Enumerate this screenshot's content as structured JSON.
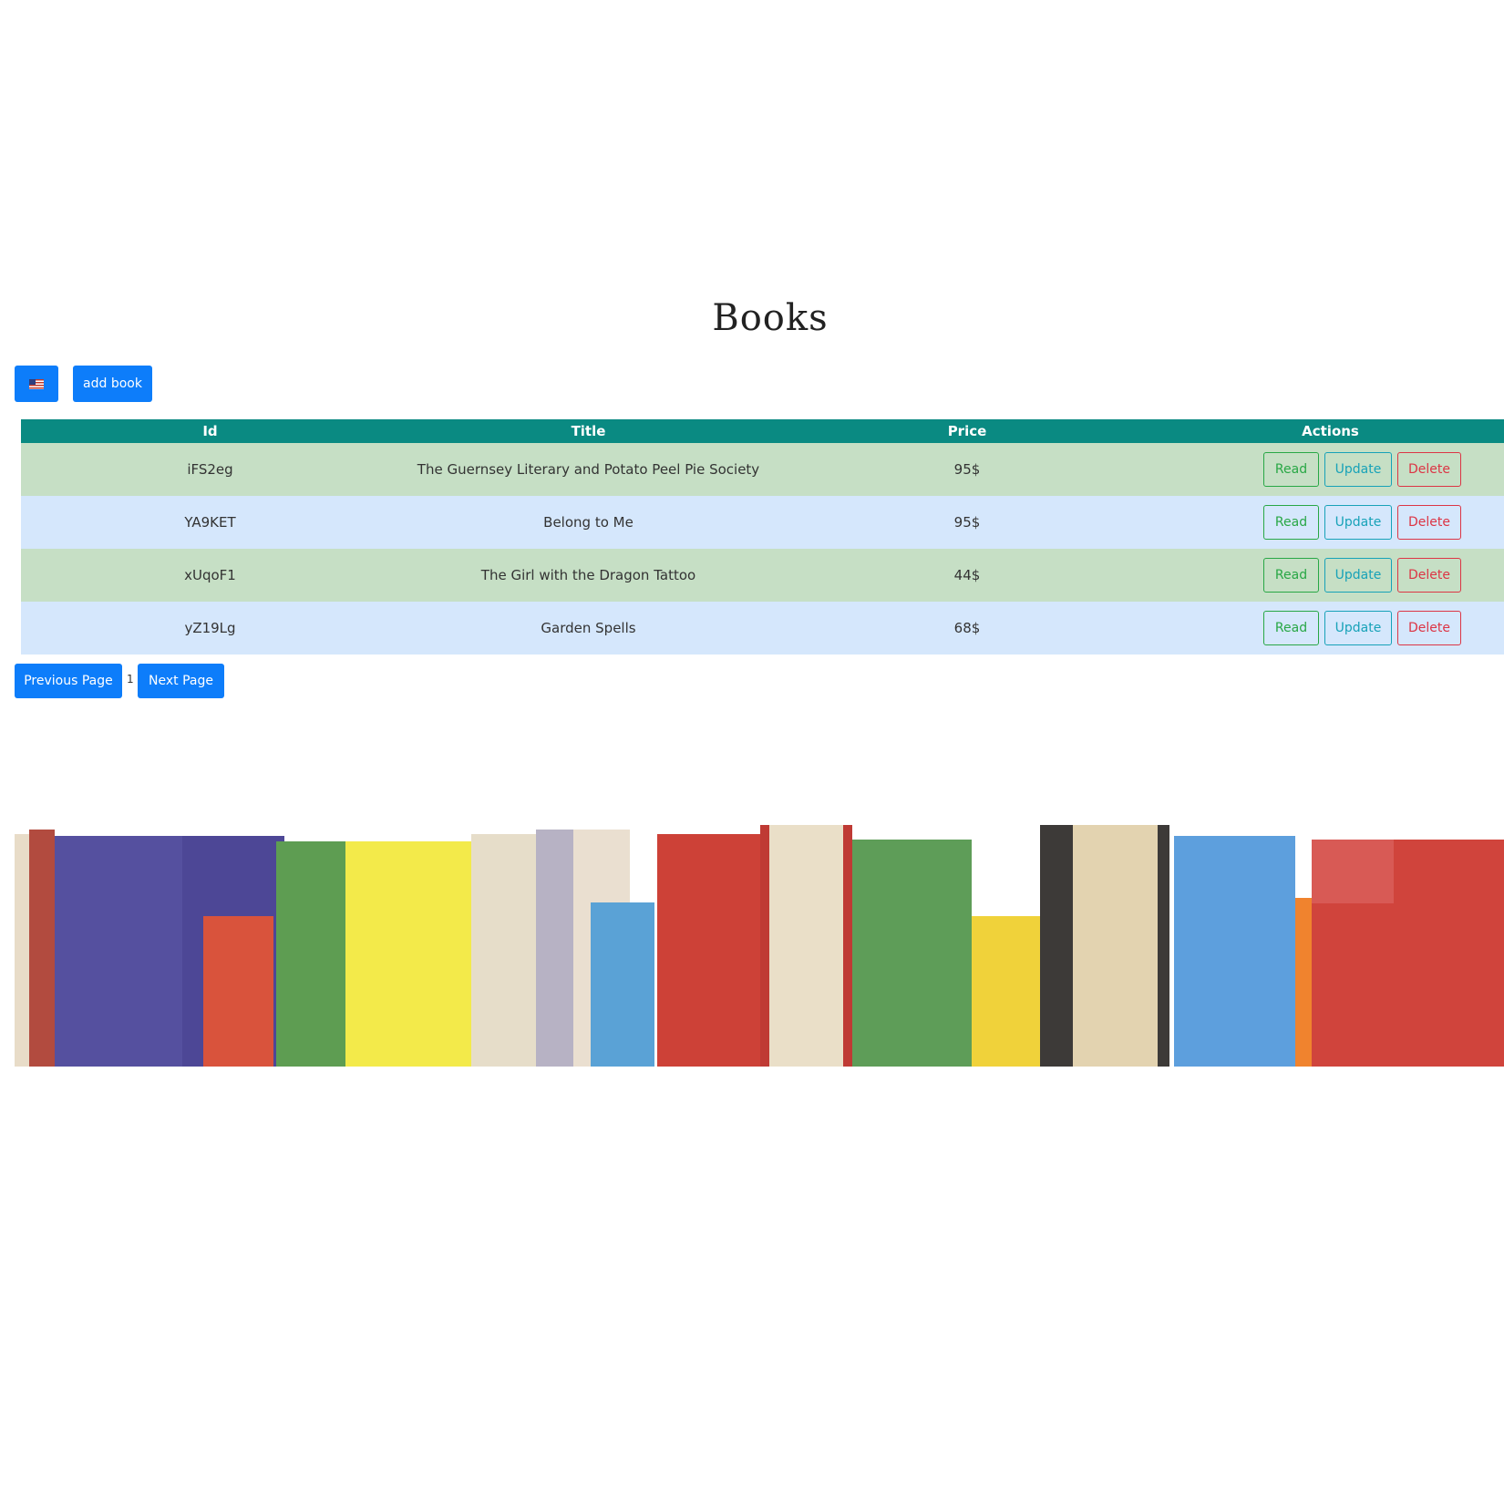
{
  "page": {
    "title": "Books"
  },
  "toolbar": {
    "language_icon": "us-flag-icon",
    "add_book_label": "add book"
  },
  "table": {
    "headers": {
      "id": "Id",
      "title": "Title",
      "price": "Price",
      "actions": "Actions"
    },
    "rows": [
      {
        "id": "iFS2eg",
        "title": "The Guernsey Literary and Potato Peel Pie Society",
        "price": "95$"
      },
      {
        "id": "YA9KET",
        "title": "Belong to Me",
        "price": "95$"
      },
      {
        "id": "xUqoF1",
        "title": "The Girl with the Dragon Tattoo",
        "price": "44$"
      },
      {
        "id": "yZ19Lg",
        "title": "Garden Spells",
        "price": "68$"
      }
    ],
    "action_labels": {
      "read": "Read",
      "update": "Update",
      "delete": "Delete"
    }
  },
  "pagination": {
    "previous_label": "Previous Page",
    "current_page": "1",
    "next_label": "Next Page"
  },
  "colors": {
    "primary": "#0d7dfa",
    "header": "#0a8a82",
    "row_green": "#c6dfc5",
    "row_blue": "#d5e7fc",
    "read": "#28a745",
    "update": "#17a2b8",
    "delete": "#dc3545"
  }
}
